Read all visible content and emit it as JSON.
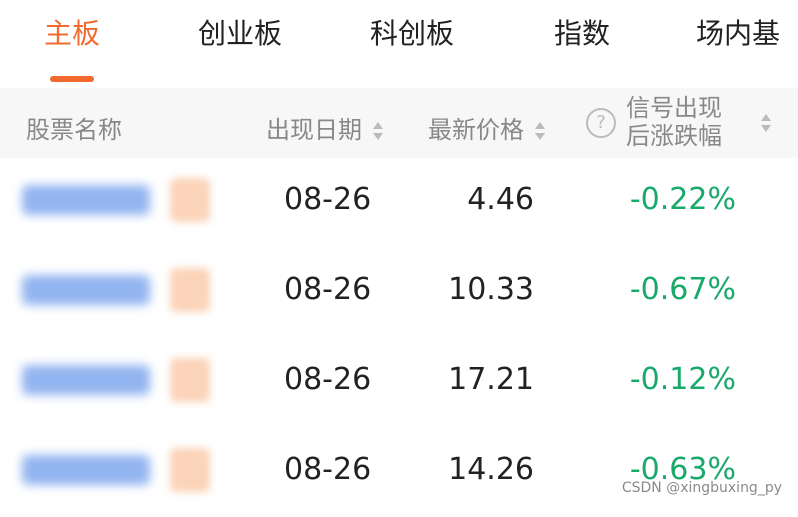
{
  "tabs": [
    {
      "label": "主板",
      "active": true
    },
    {
      "label": "创业板",
      "active": false
    },
    {
      "label": "科创板",
      "active": false
    },
    {
      "label": "指数",
      "active": false
    },
    {
      "label": "场内基",
      "active": false
    }
  ],
  "header": {
    "stock_name": "股票名称",
    "date": "出现日期",
    "price": "最新价格",
    "help_icon": "?",
    "signal_line1": "信号出现",
    "signal_line2": "后涨跌幅"
  },
  "rows": [
    {
      "date": "08-26",
      "price": "4.46",
      "change": "-0.22%"
    },
    {
      "date": "08-26",
      "price": "10.33",
      "change": "-0.67%"
    },
    {
      "date": "08-26",
      "price": "17.21",
      "change": "-0.12%"
    },
    {
      "date": "08-26",
      "price": "14.26",
      "change": "-0.63%"
    }
  ],
  "colors": {
    "accent": "#f26a2e",
    "negative": "#18a96b"
  },
  "watermark": "CSDN @xingbuxing_py"
}
